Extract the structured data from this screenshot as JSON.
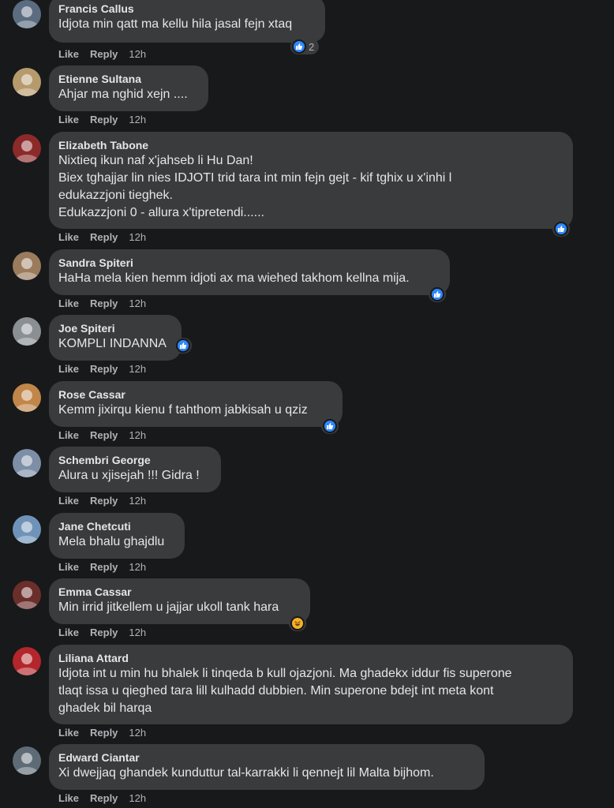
{
  "actions": {
    "like": "Like",
    "reply": "Reply"
  },
  "colors": {
    "background": "#18191a",
    "bubble": "#3a3b3c",
    "like_blue": "#2d88ff",
    "haha_yellow": "#f7b125"
  },
  "comments": [
    {
      "name": "Francis Callus",
      "lines": [
        "Idjota min qatt ma kellu hila jasal fejn xtaq"
      ],
      "time": "12h",
      "reaction": "like-icon",
      "reaction_count": "2",
      "avatar_color": "#5b6c80"
    },
    {
      "name": "Etienne Sultana",
      "lines": [
        "Ahjar ma nghid xejn ...."
      ],
      "time": "12h",
      "avatar_color": "#b79a6c"
    },
    {
      "name": "Elizabeth Tabone",
      "lines": [
        "Nixtieq ikun naf x'jahseb li Hu Dan!",
        "Biex tghajjar lin nies IDJOTI trid tara int min fejn gejt - kif tghix u x'inhi l",
        "edukazzjoni tieghek.",
        "Edukazzjoni 0 - allura x'tipretendi......"
      ],
      "time": "12h",
      "reaction": "like-icon",
      "avatar_color": "#8c2a2a"
    },
    {
      "name": "Sandra Spiteri",
      "lines": [
        "HaHa mela kien hemm idjoti ax ma wiehed takhom kellna mija."
      ],
      "time": "12h",
      "reaction": "like-icon",
      "avatar_color": "#9a7b5c"
    },
    {
      "name": "Joe Spiteri",
      "lines": [
        "KOMPLI INDANNA"
      ],
      "time": "12h",
      "reaction": "like-icon",
      "avatar_color": "#8a8f94"
    },
    {
      "name": "Rose Cassar",
      "lines": [
        "Kemm jixirqu kienu f tahthom jabkisah u qziz"
      ],
      "time": "12h",
      "reaction": "like-icon",
      "avatar_color": "#c0864a"
    },
    {
      "name": "Schembri George",
      "lines": [
        "Alura u xjisejah !!! Gidra !"
      ],
      "time": "12h",
      "avatar_color": "#7d8fa6"
    },
    {
      "name": "Jane Chetcuti",
      "lines": [
        "Mela bhalu ghajdlu"
      ],
      "time": "12h",
      "avatar_color": "#6f93b8"
    },
    {
      "name": "Emma Cassar",
      "lines": [
        "Min irrid jitkellem u jajjar ukoll tank hara"
      ],
      "time": "12h",
      "reaction": "haha-icon",
      "avatar_color": "#6a2f2a"
    },
    {
      "name": "Liliana Attard",
      "lines": [
        "Idjota int u min hu bhalek li tinqeda b kull ojazjoni. Ma ghadekx iddur fis superone",
        "tlaqt issa u qieghed tara lill kulhadd dubbien. Min superone bdejt int meta kont",
        "ghadek bil harqa"
      ],
      "time": "12h",
      "avatar_color": "#b3262b"
    },
    {
      "name": "Edward Ciantar",
      "lines": [
        "Xi dwejjaq ghandek kunduttur tal-karrakki li qennejt lil Malta bijhom."
      ],
      "time": "12h",
      "avatar_color": "#5e6b77"
    }
  ]
}
